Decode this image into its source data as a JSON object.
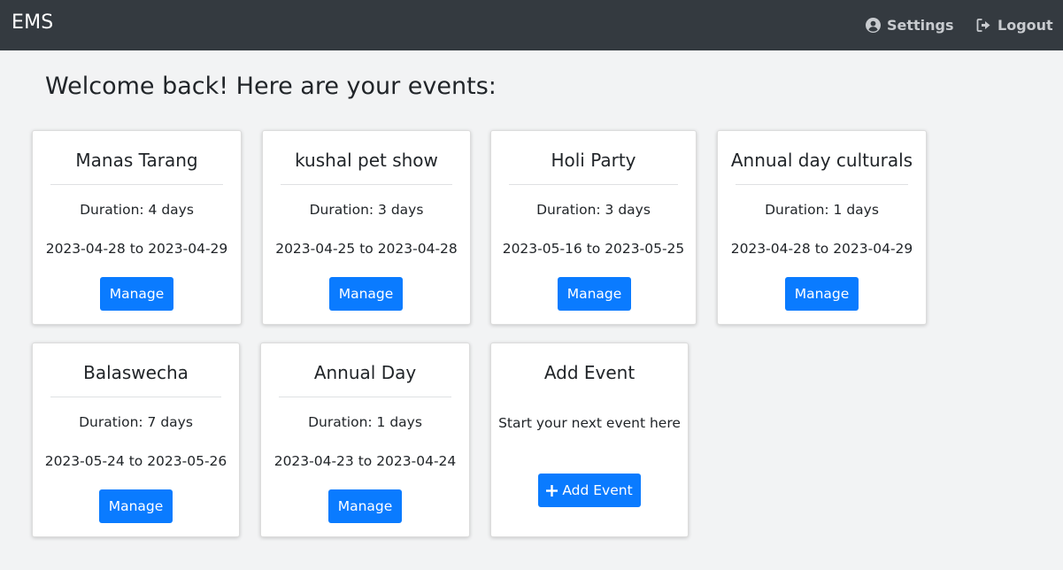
{
  "navbar": {
    "brand": "EMS",
    "settings_label": "Settings",
    "logout_label": "Logout",
    "settings_icon": "user-circle-icon",
    "logout_icon": "sign-out-icon"
  },
  "welcome": "Welcome back! Here are your events:",
  "events": [
    {
      "title": "Manas Tarang",
      "duration": "Duration: 4 days",
      "dates": "2023-04-28 to 2023-04-29",
      "button": "Manage"
    },
    {
      "title": "kushal pet show",
      "duration": "Duration: 3 days",
      "dates": "2023-04-25 to 2023-04-28",
      "button": "Manage"
    },
    {
      "title": "Holi Party",
      "duration": "Duration: 3 days",
      "dates": "2023-05-16 to 2023-05-25",
      "button": "Manage"
    },
    {
      "title": "Annual day culturals",
      "duration": "Duration: 1 days",
      "dates": "2023-04-28 to 2023-04-29",
      "button": "Manage"
    },
    {
      "title": "Balaswecha",
      "duration": "Duration: 7 days",
      "dates": "2023-05-24 to 2023-05-26",
      "button": "Manage"
    },
    {
      "title": "Annual Day",
      "duration": "Duration: 1 days",
      "dates": "2023-04-23 to 2023-04-24",
      "button": "Manage"
    }
  ],
  "add_event": {
    "title": "Add Event",
    "subtitle": "Start your next event here",
    "button": "Add Event",
    "button_icon": "plus-icon"
  },
  "colors": {
    "navbar_bg": "#343a40",
    "primary": "#0a7bff",
    "page_bg": "#f2f3f4"
  }
}
